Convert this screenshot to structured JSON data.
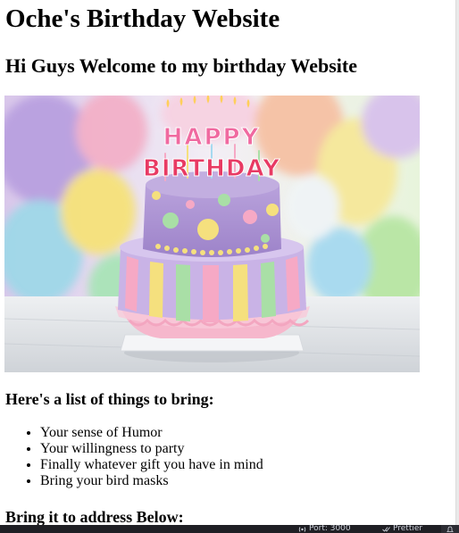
{
  "page": {
    "title": "Oche's Birthday Website",
    "welcome": "Hi Guys Welcome to my birthday Website",
    "photo": {
      "alt": "Birthday cake",
      "cake_topper_line1": "HAPPY",
      "cake_topper_line2": "BIRTHDAY"
    },
    "list_heading": "Here's a list of things to bring:",
    "things_to_bring": [
      "Your sense of Humor",
      "Your willingness to party",
      "Finally whatever gift you have in mind",
      "Bring your bird masks"
    ],
    "address_heading": "Bring it to address Below:"
  },
  "status_bar": {
    "port_label": "Port: 3000",
    "prettier_label": "Prettier",
    "port_icon": "broadcast-icon",
    "prettier_icon": "double-check-icon",
    "notification_icon": "bell-icon"
  },
  "colors": {
    "status_bar_bg": "#1f1f24",
    "status_text": "#cfd3dc",
    "page_bg": "#ffffff"
  }
}
